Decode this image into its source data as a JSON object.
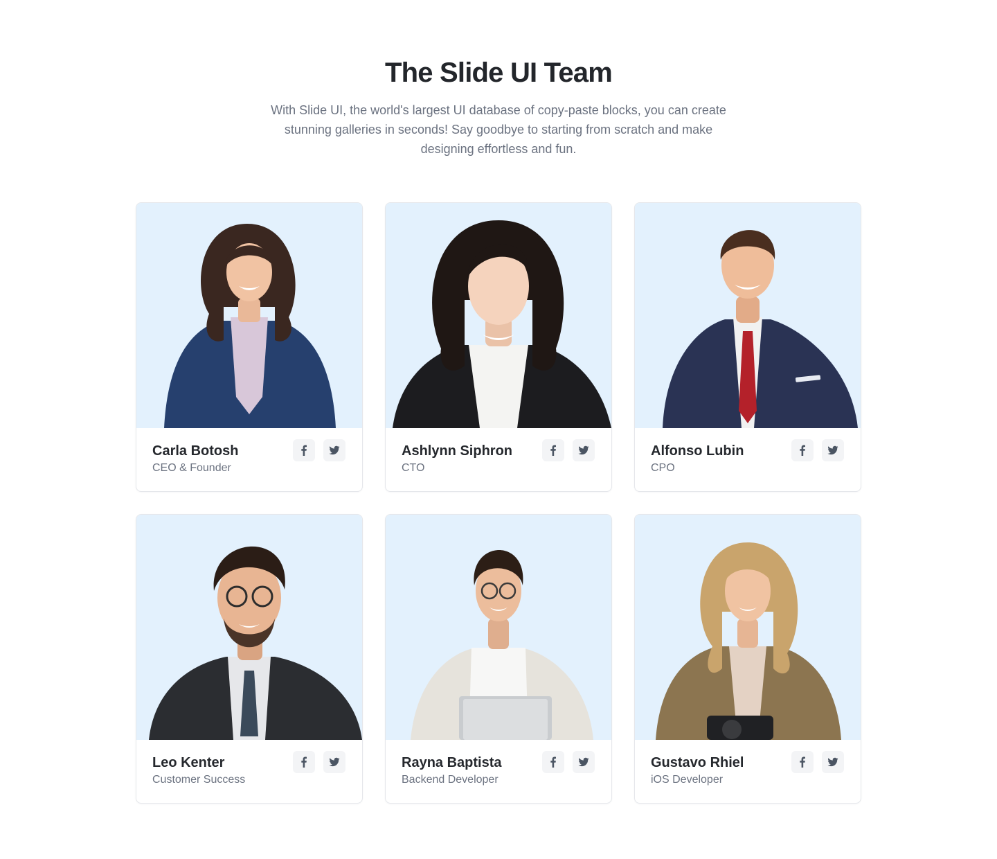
{
  "header": {
    "title": "The Slide UI Team",
    "description": "With Slide UI, the world's largest UI database of copy-paste blocks, you can create stunning galleries in seconds! Say goodbye to starting from scratch and make designing effortless and fun."
  },
  "members": [
    {
      "name": "Carla Botosh",
      "role": "CEO & Founder",
      "facebook_icon": "facebook-icon",
      "twitter_icon": "twitter-icon"
    },
    {
      "name": "Ashlynn Siphron",
      "role": "CTO",
      "facebook_icon": "facebook-icon",
      "twitter_icon": "twitter-icon"
    },
    {
      "name": "Alfonso Lubin",
      "role": "CPO",
      "facebook_icon": "facebook-icon",
      "twitter_icon": "twitter-icon"
    },
    {
      "name": "Leo Kenter",
      "role": "Customer Success",
      "facebook_icon": "facebook-icon",
      "twitter_icon": "twitter-icon"
    },
    {
      "name": "Rayna Baptista",
      "role": "Backend Developer",
      "facebook_icon": "facebook-icon",
      "twitter_icon": "twitter-icon"
    },
    {
      "name": "Gustavo Rhiel",
      "role": "iOS Developer",
      "facebook_icon": "facebook-icon",
      "twitter_icon": "twitter-icon"
    }
  ],
  "colors": {
    "photo_background": "#e3f1fd",
    "heading": "#23262b",
    "muted_text": "#6b7280",
    "icon_button_background": "#f3f4f6"
  }
}
